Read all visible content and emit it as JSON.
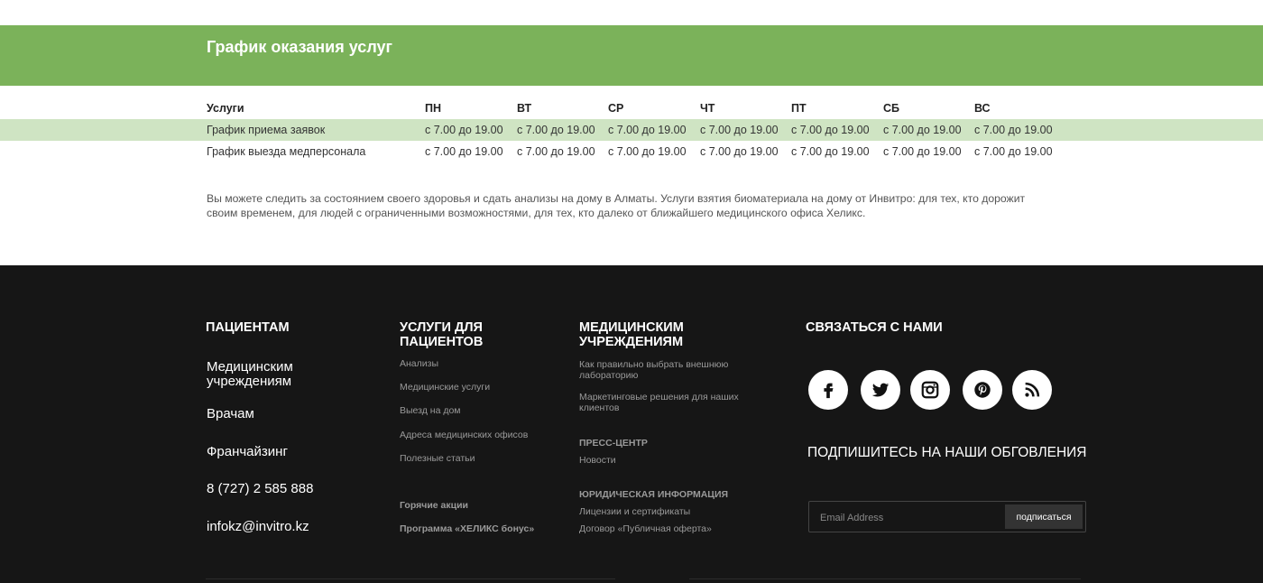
{
  "schedule": {
    "title": "График оказания услуг",
    "columns": [
      "Услуги",
      "ПН",
      "ВТ",
      "СР",
      "ЧТ",
      "ПТ",
      "СБ",
      "ВС"
    ],
    "rows": [
      [
        "График приема заявок",
        "с 7.00 до 19.00",
        "с 7.00 до 19.00",
        "с 7.00 до 19.00",
        "с 7.00 до 19.00",
        "с 7.00 до 19.00",
        "с 7.00 до 19.00",
        "с 7.00 до 19.00"
      ],
      [
        "График выезда медперсонала",
        "с 7.00 до 19.00",
        "с 7.00 до 19.00",
        "с 7.00 до 19.00",
        "с 7.00 до 19.00",
        "с 7.00 до 19.00",
        "с 7.00 до 19.00",
        "с 7.00 до 19.00"
      ]
    ],
    "info_text": "Вы можете следить за состоянием своего здоровья и сдать анализы на дому в Алматы. Услуги взятия биоматериала на дому от Инвитро: для тех, кто дорожит своим временем, для людей с ограниченными возможностями, для тех, кто далеко от ближайшего медицинского офиса Хеликс."
  },
  "footer": {
    "col1": {
      "heading": "Пациентам",
      "links": [
        "Медицинским учреждениям",
        "Врачам",
        "Франчайзинг"
      ],
      "phone": "8 (727) 2 585 888",
      "email": "infokz@invitro.kz"
    },
    "col2": {
      "heading": "Услуги для пациентов",
      "links": [
        "Анализы",
        "Медицинские услуги",
        "Выезд на дом",
        "Адреса медицинских офисов",
        "Полезные статьи"
      ],
      "bold_links": [
        "Горячие акции",
        "Программа «ХЕЛИКС бонус»"
      ]
    },
    "col3": {
      "heading": "Медицинским учреждениям",
      "links": [
        "Как правильно выбрать внешнюю лабораторию",
        "Маркетинговые решения для наших клиентов"
      ],
      "press_heading": "Пресс-центр",
      "press_links": [
        "Новости"
      ],
      "legal_heading": "Юридическая информация",
      "legal_links": [
        "Лицензии и сертификаты",
        "Договор «Публичная оферта»"
      ]
    },
    "col4": {
      "heading": "Связаться с нами",
      "social": [
        "facebook-icon",
        "twitter-icon",
        "instagram-icon",
        "pinterest-icon",
        "rss-icon"
      ],
      "subscribe_title": "Подпишитесь на наши обговления",
      "email_placeholder": "Email Address",
      "subscribe_button": "подписаться"
    }
  },
  "colors": {
    "accent": "#7bb25a",
    "highlight_row": "#cfe4c3",
    "footer_bg": "#161616"
  }
}
